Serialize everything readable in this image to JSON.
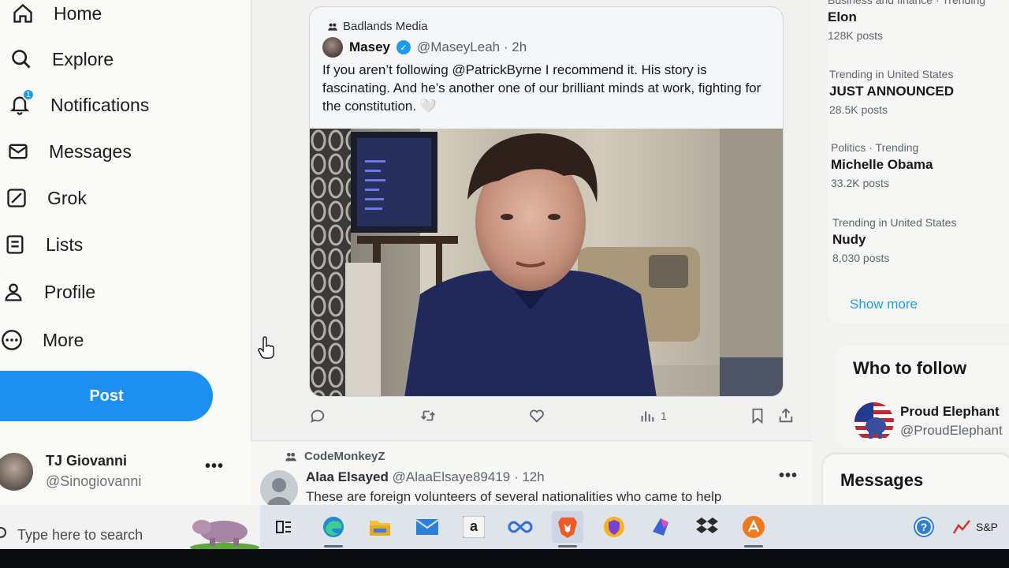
{
  "nav": {
    "home": "Home",
    "explore": "Explore",
    "notifications": "Notifications",
    "notifications_badge": "1",
    "messages": "Messages",
    "grok": "Grok",
    "lists": "Lists",
    "profile": "Profile",
    "more": "More",
    "post_button": "Post"
  },
  "account": {
    "name": "TJ Giovanni",
    "handle": "@Sinogiovanni",
    "more": "•••"
  },
  "quoted_post": {
    "community": "Badlands Media",
    "author_name": "Masey",
    "author_handle": "@MaseyLeah · 2h",
    "text": "If you aren’t following @PatrickByrne I recommend it. His story is fascinating. And he’s another one of our brilliant minds at work, fighting for the constitution.",
    "heart_emoji": "🤍"
  },
  "post_actions": {
    "views_count": "1"
  },
  "next_post": {
    "community": "CodeMonkeyZ",
    "author_name": "Alaa Elsayed",
    "author_handle": "@AlaaElsaye89419 · 12h",
    "text": "These are foreign volunteers of several nationalities who came to help",
    "more": "•••"
  },
  "trends": [
    {
      "meta": "Business and finance · Trending",
      "name": "Elon",
      "count": "128K posts"
    },
    {
      "meta": "Trending in United States",
      "name": "JUST ANNOUNCED",
      "count": "28.5K posts"
    },
    {
      "meta": "Politics · Trending",
      "name": "Michelle Obama",
      "count": "33.2K posts"
    },
    {
      "meta": "Trending in United States",
      "name": "Nudy",
      "count": "8,030 posts"
    }
  ],
  "show_more": "Show more",
  "who_to_follow": {
    "title": "Who to follow",
    "name": "Proud Elephant",
    "handle": "@ProudElephant"
  },
  "messages_drawer": {
    "title": "Messages"
  },
  "taskbar": {
    "search_placeholder": "Type here to search",
    "tray_text": "S&P"
  },
  "colors": {
    "accent": "#1d9bf0",
    "post_button": "#1d8ff0",
    "text_primary": "#0f1419",
    "text_secondary": "#5c666f"
  }
}
